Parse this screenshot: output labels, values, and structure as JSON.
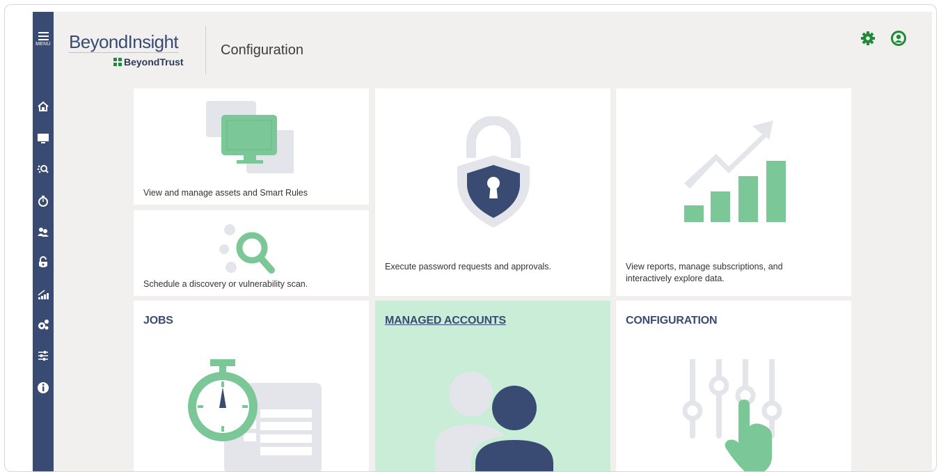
{
  "header": {
    "menu_label": "MENU",
    "logo_main": "BeyondInsight",
    "logo_sub": "BeyondTrust",
    "page_title": "Configuration"
  },
  "sidebar": {
    "items": [
      {
        "icon": "home-icon"
      },
      {
        "icon": "monitor-icon"
      },
      {
        "icon": "discovery-scan-icon"
      },
      {
        "icon": "stopwatch-icon"
      },
      {
        "icon": "users-icon"
      },
      {
        "icon": "unlock-icon"
      },
      {
        "icon": "analytics-icon"
      },
      {
        "icon": "gears-icon"
      },
      {
        "icon": "sliders-icon"
      },
      {
        "icon": "info-icon"
      }
    ]
  },
  "tiles": {
    "assets": {
      "desc": "View and manage assets and Smart Rules"
    },
    "scan": {
      "desc": "Schedule a discovery or vulnerability scan."
    },
    "password": {
      "desc": "Execute password requests and approvals."
    },
    "reports": {
      "desc": "View reports, manage subscriptions, and interactively explore data."
    },
    "jobs": {
      "title": "JOBS"
    },
    "managed_accounts": {
      "title": "MANAGED ACCOUNTS"
    },
    "configuration": {
      "title": "CONFIGURATION"
    }
  },
  "colors": {
    "sidebar": "#3a4b73",
    "accent_green": "#7cc797",
    "brand_green": "#1f8a3a",
    "navy": "#3a4b73",
    "active_tile": "#c9edd6"
  }
}
